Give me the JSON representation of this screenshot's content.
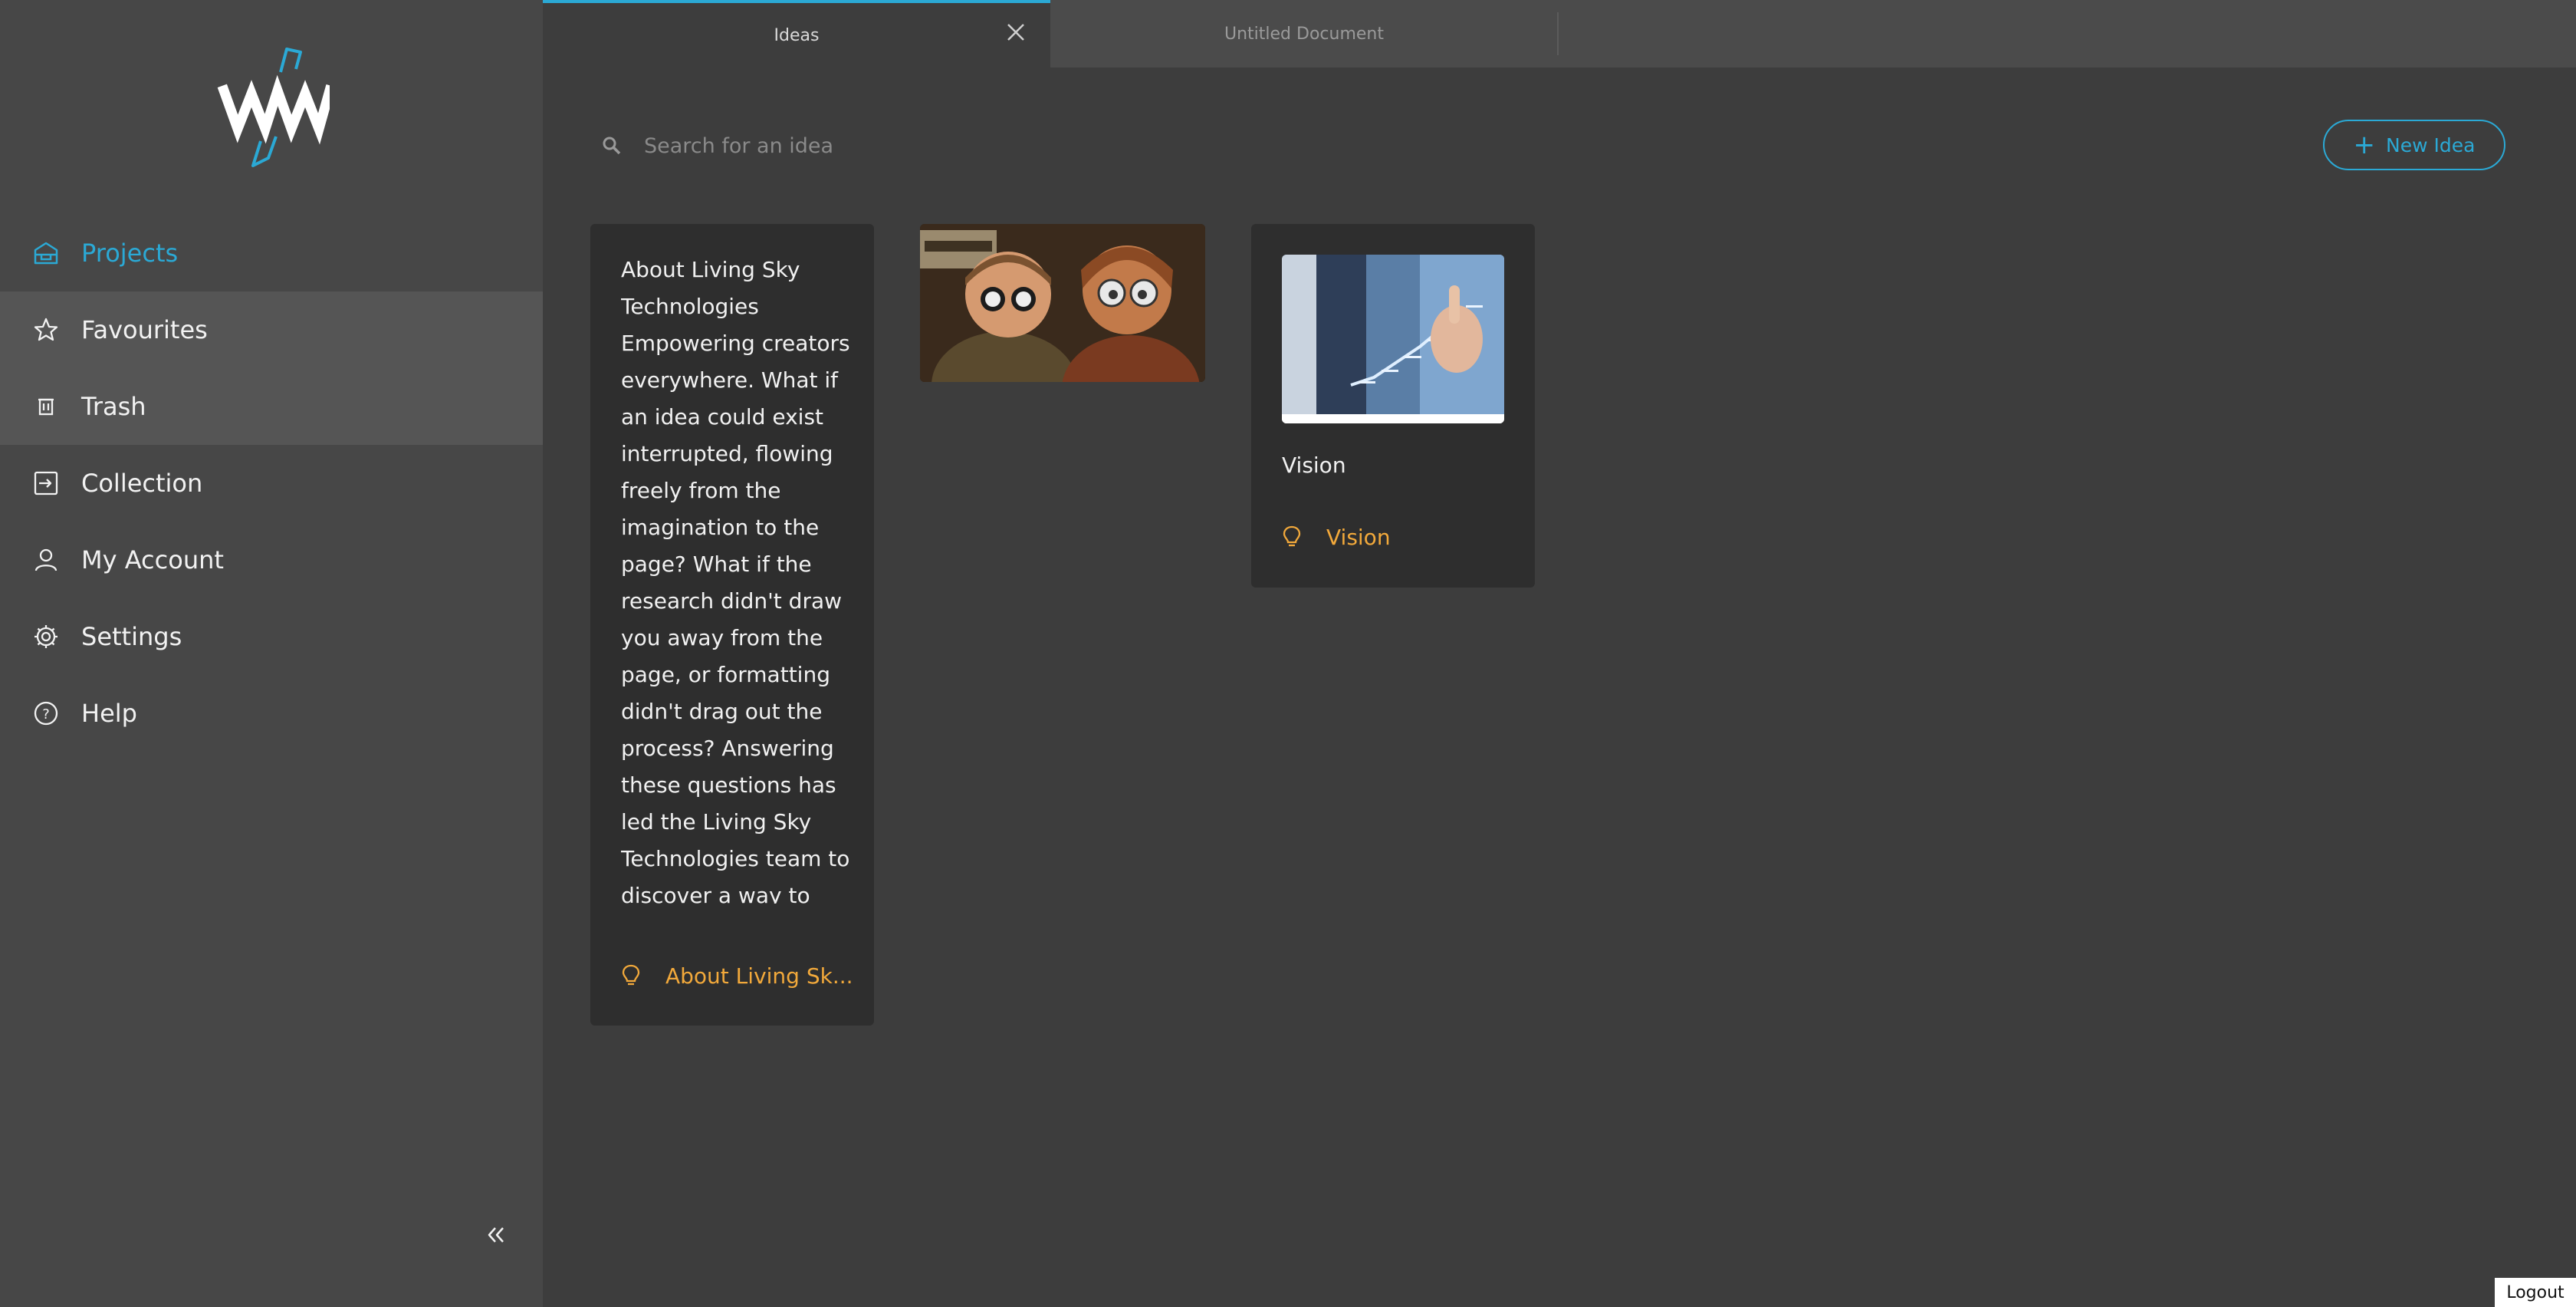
{
  "colors": {
    "accent": "#2ba9d5",
    "tag": "#f2a93b",
    "sidebar": "#474747",
    "background": "#3d3d3d",
    "card": "#2e2e2e"
  },
  "sidebar": {
    "logo_icon": "ww-logo",
    "items": [
      {
        "label": "Projects",
        "icon": "projects-icon",
        "active": true
      },
      {
        "label": "Favourites",
        "icon": "star-icon"
      },
      {
        "label": "Trash",
        "icon": "trash-icon"
      },
      {
        "label": "Collection",
        "icon": "collection-icon"
      },
      {
        "label": "My Account",
        "icon": "user-icon"
      },
      {
        "label": "Settings",
        "icon": "gear-icon"
      },
      {
        "label": "Help",
        "icon": "help-icon"
      }
    ],
    "collapse_icon": "double-chevron-left-icon"
  },
  "tabs": [
    {
      "label": "Ideas",
      "active": true
    },
    {
      "label": "Untitled Document",
      "active": false
    }
  ],
  "search": {
    "placeholder": "Search for an idea",
    "value": ""
  },
  "toolbar": {
    "new_idea_label": "New Idea"
  },
  "cards": [
    {
      "text": "About Living Sky Technologies Empowering creators everywhere. What if an idea could exist interrupted, flowing freely from the imagination to the page? What if the research didn't draw you away from the page, or formatting didn't drag out the process? Answering these questions has led the Living Sky Technologies team to discover a way to",
      "tag": "About Living Sk..."
    },
    {
      "image": "animated-characters-image"
    },
    {
      "image": "business-chart-image",
      "title": "Vision",
      "tag": "Vision"
    }
  ],
  "footer": {
    "logout_label": "Logout"
  }
}
